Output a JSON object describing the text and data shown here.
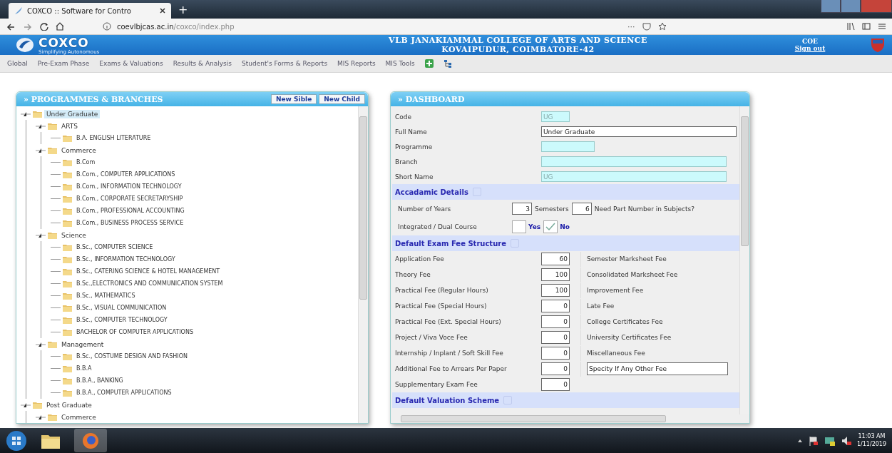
{
  "browser": {
    "tabs": [
      {
        "title": "COXCO :: Software for Contro",
        "selected": true
      }
    ],
    "new_tab": "+",
    "url_host": "coevlbjcas.ac.in",
    "url_path": "/coxco/index.php",
    "more": "···"
  },
  "header": {
    "logo": "COXCO",
    "tagline": "Simplifying Autonomous",
    "college": [
      "VLB JANAKIAMMAL COLLEGE OF ARTS AND SCIENCE",
      "KOVAIPUDUR, COIMBATORE-42"
    ],
    "user": "COE",
    "sign_out": "Sign out"
  },
  "menu": [
    "Global",
    "Pre-Exam Phase",
    "Exams & Valuations",
    "Results & Analysis",
    "Student's Forms & Reports",
    "MIS Reports",
    "MIS Tools"
  ],
  "programmes": {
    "title": "» PROGRAMMES & BRANCHES",
    "buttons": [
      "New Sible",
      "New Child"
    ],
    "tree": [
      {
        "label": "Under Graduate",
        "selected": true,
        "expanded": true,
        "children": [
          {
            "label": "ARTS",
            "selected": false,
            "expanded": true,
            "children": [
              {
                "label": "B.A. ENGLISH LITERATURE",
                "selected": false,
                "expanded": false
              }
            ]
          },
          {
            "label": "Commerce",
            "selected": false,
            "expanded": true,
            "children": [
              {
                "label": "B.Com",
                "selected": false,
                "expanded": false
              },
              {
                "label": "B.Com., COMPUTER APPLICATIONS",
                "selected": false,
                "expanded": false
              },
              {
                "label": "B.Com., INFORMATION TECHNOLOGY",
                "selected": false,
                "expanded": false
              },
              {
                "label": "B.Com., CORPORATE SECRETARYSHIP",
                "selected": false,
                "expanded": false
              },
              {
                "label": "B.Com., PROFESSIONAL ACCOUNTING",
                "selected": false,
                "expanded": false
              },
              {
                "label": "B.Com., BUSINESS PROCESS SERVICE",
                "selected": false,
                "expanded": false
              }
            ]
          },
          {
            "label": "Science",
            "selected": false,
            "expanded": true,
            "children": [
              {
                "label": "B.Sc., COMPUTER SCIENCE",
                "selected": false,
                "expanded": false
              },
              {
                "label": "B.Sc., INFORMATION TECHNOLOGY",
                "selected": false,
                "expanded": false
              },
              {
                "label": "B.Sc., CATERING SCIENCE & HOTEL MANAGEMENT",
                "selected": false,
                "expanded": false
              },
              {
                "label": "B.Sc.,ELECTRONICS AND COMMUNICATION SYSTEM",
                "selected": false,
                "expanded": false
              },
              {
                "label": "B.Sc., MATHEMATICS",
                "selected": false,
                "expanded": false
              },
              {
                "label": "B.Sc., VISUAL COMMUNICATION",
                "selected": false,
                "expanded": false
              },
              {
                "label": "B.Sc., COMPUTER TECHNOLOGY",
                "selected": false,
                "expanded": false
              },
              {
                "label": "BACHELOR OF COMPUTER APPLICATIONS",
                "selected": false,
                "expanded": false
              }
            ]
          },
          {
            "label": "Management",
            "selected": false,
            "expanded": true,
            "children": [
              {
                "label": "B.Sc., COSTUME DESIGN AND FASHION",
                "selected": false,
                "expanded": false
              },
              {
                "label": "B.B.A",
                "selected": false,
                "expanded": false
              },
              {
                "label": "B.B.A., BANKING",
                "selected": false,
                "expanded": false
              },
              {
                "label": "B.B.A., COMPUTER APPLICATIONS",
                "selected": false,
                "expanded": false
              }
            ]
          }
        ]
      },
      {
        "label": "Post Graduate",
        "selected": false,
        "expanded": true,
        "children": [
          {
            "label": "Commerce",
            "selected": false,
            "expanded": true
          }
        ]
      }
    ]
  },
  "dashboard": {
    "title": "» DASHBOARD",
    "fields": [
      {
        "label": "Code",
        "value": "UG",
        "kind": "short",
        "readonly": true
      },
      {
        "label": "Full Name",
        "value": "Under Graduate",
        "kind": "full",
        "readonly": false
      },
      {
        "label": "Programme",
        "kind": "medium",
        "readonly": true
      },
      {
        "label": "Branch",
        "kind": "wide",
        "readonly": true
      },
      {
        "label": "Short Name",
        "value": "UG",
        "kind": "wide",
        "readonly": true
      }
    ],
    "academic": {
      "title": "Accadamic Details",
      "years_label": "Number of Years",
      "years": "3",
      "semesters_label": "Semesters",
      "semesters": "6",
      "part_label": "Need Part Number in Subjects?",
      "dual_label": "Integrated / Dual Course",
      "options": [
        {
          "label": "Yes",
          "checked": false
        },
        {
          "label": "No",
          "checked": true
        }
      ]
    },
    "fees": {
      "title": "Default Exam Fee Structure",
      "rows": [
        {
          "label": "Application Fee",
          "value": "60",
          "right": {
            "kind": "label",
            "text": "Semester Marksheet Fee"
          }
        },
        {
          "label": "Theory Fee",
          "value": "100",
          "right": {
            "kind": "label",
            "text": "Consolidated Marksheet Fee"
          }
        },
        {
          "label": "Practical Fee (Regular Hours)",
          "value": "100",
          "right": {
            "kind": "label",
            "text": "Improvement Fee"
          }
        },
        {
          "label": "Practical Fee (Special Hours)",
          "value": "0",
          "right": {
            "kind": "label",
            "text": "Late Fee"
          }
        },
        {
          "label": "Practical Fee (Ext. Special Hours)",
          "value": "0",
          "right": {
            "kind": "label",
            "text": "College Certificates Fee"
          }
        },
        {
          "label": "Project / Viva Voce Fee",
          "value": "0",
          "right": {
            "kind": "label",
            "text": "University Certificates Fee"
          }
        },
        {
          "label": "Internship / Inplant / Soft Skill Fee",
          "value": "0",
          "right": {
            "kind": "label",
            "text": "Miscellaneous Fee"
          }
        },
        {
          "label": "Additional Fee to Arrears Per Paper",
          "value": "0",
          "right": {
            "kind": "field",
            "text": "Specity If Any Other Fee"
          }
        },
        {
          "label": "Supplementary Exam Fee",
          "value": "0"
        }
      ]
    },
    "valuation": {
      "title": "Default Valuation Scheme"
    }
  },
  "taskbar": {
    "apps": [
      {
        "kind": "explorer",
        "selected": false
      },
      {
        "kind": "firefox",
        "selected": true
      }
    ],
    "time": "11:03 AM",
    "date": "1/11/2019"
  }
}
